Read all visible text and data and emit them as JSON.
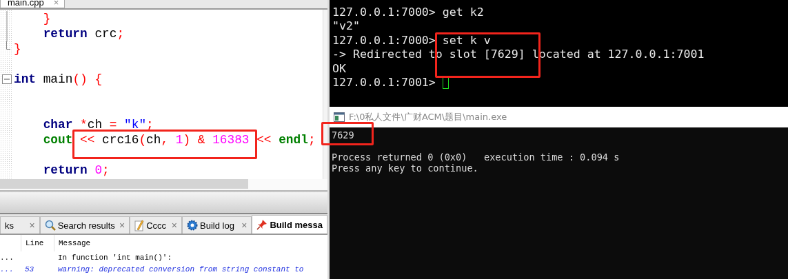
{
  "editor": {
    "tab": {
      "label": "main.cpp",
      "close": "×"
    },
    "lines": [
      {
        "tokens": [
          {
            "kind": "op",
            "text": "    }"
          }
        ]
      },
      {
        "tokens": [
          {
            "kind": "keyword",
            "text": "    return"
          },
          {
            "kind": "ident",
            "text": " crc"
          },
          {
            "kind": "op",
            "text": ";"
          }
        ]
      },
      {
        "tokens": [
          {
            "kind": "op",
            "text": "}"
          }
        ]
      },
      {
        "tokens": [
          {
            "kind": "keyword",
            "text": "int"
          },
          {
            "kind": "ident",
            "text": " main"
          },
          {
            "kind": "op",
            "text": "() {"
          }
        ]
      },
      {
        "tokens": [
          {
            "kind": "keyword",
            "text": "    char"
          },
          {
            "kind": "op",
            "text": " *"
          },
          {
            "kind": "ident",
            "text": "ch"
          },
          {
            "kind": "op",
            "text": " = "
          },
          {
            "kind": "string",
            "text": "\"k\""
          },
          {
            "kind": "op",
            "text": ";"
          }
        ]
      },
      {
        "tokens": [
          {
            "kind": "std",
            "text": "    cout"
          },
          {
            "kind": "op",
            "text": " <<"
          },
          {
            "kind": "ident",
            "text": " crc16"
          },
          {
            "kind": "op",
            "text": "("
          },
          {
            "kind": "ident",
            "text": "ch"
          },
          {
            "kind": "op",
            "text": ","
          },
          {
            "kind": "number",
            "text": " 1"
          },
          {
            "kind": "op",
            "text": ") & "
          },
          {
            "kind": "number",
            "text": "16383"
          },
          {
            "kind": "op",
            "text": " << "
          },
          {
            "kind": "std",
            "text": "endl"
          },
          {
            "kind": "op",
            "text": ";"
          }
        ]
      },
      {
        "tokens": [
          {
            "kind": "keyword",
            "text": "    return"
          },
          {
            "kind": "number",
            "text": " 0"
          },
          {
            "kind": "op",
            "text": ";"
          }
        ]
      }
    ]
  },
  "log_tabs": [
    {
      "label": "ks",
      "selected": false,
      "close": "×"
    },
    {
      "label": "Search results",
      "selected": false,
      "close": "×"
    },
    {
      "label": "Cccc",
      "selected": false,
      "close": "×"
    },
    {
      "label": "Build log",
      "selected": false,
      "close": "×"
    },
    {
      "label": "Build messa",
      "selected": true
    }
  ],
  "messages": {
    "columns": [
      "Line",
      "Message"
    ],
    "rows": [
      {
        "kind": "note",
        "file": "...",
        "line": "",
        "message": "In function 'int main()':"
      },
      {
        "kind": "warning",
        "file": "...",
        "line": "53",
        "message": "warning: deprecated conversion from string constant to"
      }
    ]
  },
  "terminal": {
    "lines": [
      {
        "text": "127.0.0.1:7000> get k2"
      },
      {
        "text": "\"v2\""
      },
      {
        "text": "127.0.0.1:7000> set k v"
      },
      {
        "text": "-> Redirected to slot [7629] located at 127.0.0.1:7001"
      },
      {
        "text": "OK"
      },
      {
        "text": "127.0.0.1:7001> ",
        "cursor": true
      }
    ]
  },
  "console": {
    "title": "F:\\0私人文件\\广财ACM\\题目\\main.exe",
    "lines": [
      {
        "text": "7629"
      },
      {
        "text": "Process returned 0 (0x0)   execution time : 0.094 s"
      },
      {
        "text": "Press any key to continue."
      }
    ]
  }
}
